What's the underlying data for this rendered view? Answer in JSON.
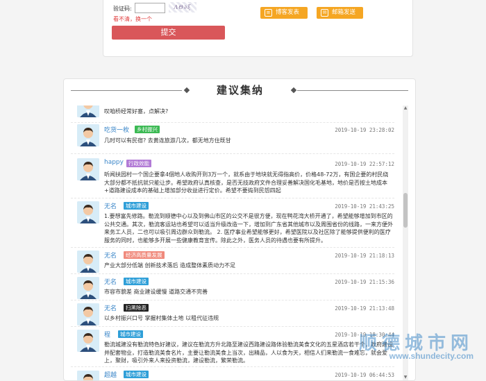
{
  "form": {
    "captcha_label": "验证码:",
    "captcha_image_text": "ΛΘ∂ξ",
    "captcha_refresh": "看不清，换一个",
    "submit_label": "提交",
    "share_weibo": "博客发表",
    "share_mail": "邮箱发送"
  },
  "section": {
    "title": "建议集纳"
  },
  "entries": [
    {
      "name": "",
      "tag": "",
      "time": "",
      "body": "叹咱桥经常好塞，点解决?"
    },
    {
      "name": "吃货一枚",
      "tag": "乡村振兴",
      "time": "2019-10-19 23:28:02",
      "body": "几时可以有民宿? 去黄连旅游几次，都无地方住既甘"
    },
    {
      "name": "happy",
      "tag": "行政效能",
      "time": "2019-10-19 22:57:12",
      "body": "听闻扶园村一个国企要拿4個地人收购开到3万一个，就系由于地块就无得指高价，价格48-72万，有国企要的村民绕大部分都不抵抗就只能让步。希望政府认真核查，是否无技政府文件合理妥善解决国化毛基地，地价是否按土地成本+道路建设成本的基础上增加部分收益进行定价。希望不要捣到民怨四起"
    },
    {
      "name": "无名",
      "tag": "城市建设",
      "time": "2019-10-19 21:43:25",
      "body": "1.要想富先修路。勒流到顺德中心以及到佛山市区的公交不是很方便，现在鸭花湾大桥开通了，希望能够增加到市区的公共交通。其次，勒流客运站也希望可以适当升级改造一下，增加到广东省其他城市以及周围省份的线路，一来方便外来务工人员，二也可以吸引周边群众到勒流。 2. 医疗事业希望能够更好，希望医院以及社区除了能够提供便利的医疗服务的同时，也能够多开展一些健康教育宣传。除此之外，医务人员的待遇也要有所提升。"
    },
    {
      "name": "无名",
      "tag": "经济高质量发展",
      "time": "2019-10-19 21:18:13",
      "body": "产业大部分低端 创新技术落后 造成整体素质动力不足"
    },
    {
      "name": "无名",
      "tag": "城市建设",
      "time": "2019-10-19 21:15:36",
      "body": "市容市貌差 商业建设缓慢 道路交通不完善"
    },
    {
      "name": "无名",
      "tag": "扫黑除恶",
      "time": "2019-10-19 21:13:48",
      "body": "以乡村振兴口号 掌握村集体土地 以租代征违规"
    },
    {
      "name": "程",
      "tag": "城市建设",
      "time": "2019-10-19 18:30:44",
      "body": "勒流城建没有勒流特色好建议，建议在勒流方升北路至建设西路建设路体验勒流美食文化的五星酒店若干个，政府建设并配套物业，打造勒流美食名片，主要让勒流美食上当次，出精品，人以食为天，相信人们来勒流一食难忘，就会爱上，聚财，吸引外来人来投资勒流，建设勒流，繁荣勒流。"
    },
    {
      "name": "超越",
      "tag": "城市建设",
      "time": "2019-10-19 06:44:53",
      "body": ""
    }
  ],
  "watermark": {
    "brand": "顺德城市网",
    "url": "www.shundecity.com"
  },
  "colors": {
    "submit": "#d9575a",
    "share": "#f5a623",
    "link": "#3a86c8",
    "tag_green": "#3cba54",
    "tag_purple": "#b27bd6",
    "tag_blue": "#2f9fd8",
    "tag_salmon": "#f08a7c",
    "tag_black": "#222222"
  }
}
